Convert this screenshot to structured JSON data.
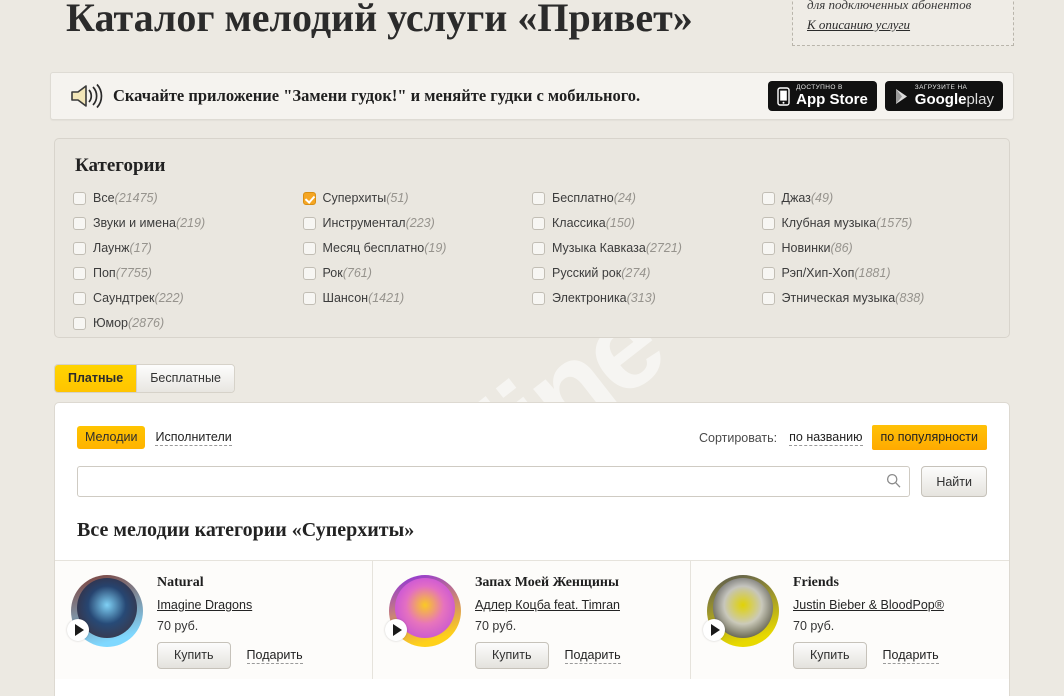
{
  "header": {
    "title": "Каталог мелодий услуги «Привет»",
    "note_text": "для подключенных абонентов",
    "note_link": "К описанию услуги"
  },
  "banner": {
    "icon": "speaker-icon",
    "text": "Скачайте приложение \"Замени гудок!\" и меняйте гудки с мобильного.",
    "appstore_small": "Доступно в",
    "appstore_big": "App Store",
    "googleplay_small": "Загрузите на",
    "googleplay_big": "Google",
    "googleplay_big_light": "play"
  },
  "categories": {
    "title": "Категории",
    "columns": [
      [
        {
          "label": "Все",
          "count": "(21475)",
          "checked": false
        },
        {
          "label": "Звуки и имена",
          "count": "(219)",
          "checked": false
        },
        {
          "label": "Лаунж",
          "count": "(17)",
          "checked": false
        },
        {
          "label": "Поп",
          "count": "(7755)",
          "checked": false
        },
        {
          "label": "Саундтрек",
          "count": "(222)",
          "checked": false
        },
        {
          "label": "Юмор",
          "count": "(2876)",
          "checked": false
        }
      ],
      [
        {
          "label": "Суперхиты",
          "count": "(51)",
          "checked": true
        },
        {
          "label": "Инструментал",
          "count": "(223)",
          "checked": false
        },
        {
          "label": "Месяц бесплатно",
          "count": "(19)",
          "checked": false
        },
        {
          "label": "Рок",
          "count": "(761)",
          "checked": false
        },
        {
          "label": "Шансон",
          "count": "(1421)",
          "checked": false
        }
      ],
      [
        {
          "label": "Бесплатно",
          "count": "(24)",
          "checked": false
        },
        {
          "label": "Классика",
          "count": "(150)",
          "checked": false
        },
        {
          "label": "Музыка Кавказа",
          "count": "(2721)",
          "checked": false
        },
        {
          "label": "Русский рок",
          "count": "(274)",
          "checked": false
        },
        {
          "label": "Электроника",
          "count": "(313)",
          "checked": false
        }
      ],
      [
        {
          "label": "Джаз",
          "count": "(49)",
          "checked": false
        },
        {
          "label": "Клубная музыка",
          "count": "(1575)",
          "checked": false
        },
        {
          "label": "Новинки",
          "count": "(86)",
          "checked": false
        },
        {
          "label": "Рэп/Хип-Хоп",
          "count": "(1881)",
          "checked": false
        },
        {
          "label": "Этническая музыка",
          "count": "(838)",
          "checked": false
        }
      ]
    ]
  },
  "paid_tabs": [
    {
      "label": "Платные",
      "active": true
    },
    {
      "label": "Бесплатные",
      "active": false
    }
  ],
  "view_tabs": [
    {
      "label": "Мелодии",
      "active": true
    },
    {
      "label": "Исполнители",
      "active": false
    }
  ],
  "sort": {
    "label": "Сортировать:",
    "options": [
      {
        "label": "по названию",
        "active": false
      },
      {
        "label": "по популярности",
        "active": true
      }
    ]
  },
  "search": {
    "value": "",
    "placeholder": "",
    "icon": "search-icon",
    "button_label": "Найти"
  },
  "results": {
    "heading": "Все мелодии категории «Суперхиты»",
    "tracks": [
      {
        "title": "Natural",
        "artist": "Imagine Dragons",
        "price": "70 руб.",
        "buy_label": "Купить",
        "gift_label": "Подарить",
        "cover_colors": [
          "#3a1f24",
          "#7d3b33",
          "#1d3f6e",
          "#7fd8ff"
        ]
      },
      {
        "title": "Запах Моей Женщины",
        "artist": "Адлер Коцба feat. Timran",
        "price": "70 руб.",
        "buy_label": "Купить",
        "gift_label": "Подарить",
        "cover_colors": [
          "#b43cf0",
          "#8a2be2",
          "#e86fc8",
          "#ffd11a"
        ]
      },
      {
        "title": "Friends",
        "artist": "Justin Bieber & BloodPop®",
        "price": "70 руб.",
        "buy_label": "Купить",
        "gift_label": "Подарить",
        "cover_colors": [
          "#1a1a1a",
          "#555555",
          "#cccccc",
          "#e8d900"
        ]
      }
    ]
  },
  "watermark": "beeline",
  "colors": {
    "page_bg": "#ece9e2",
    "panel_bg": "#eae7e0",
    "accent_yellow": "#ffc400",
    "accent_orange": "#f5a623",
    "text": "#2b2b2b"
  }
}
